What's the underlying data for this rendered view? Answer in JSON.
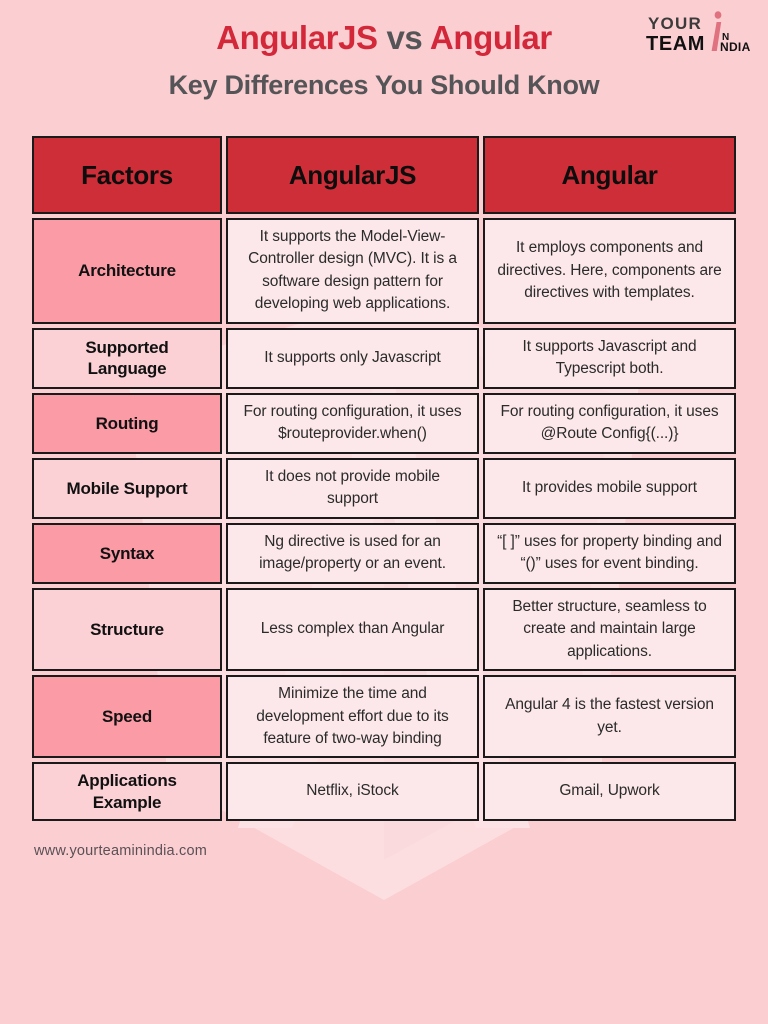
{
  "header": {
    "title_part1": "AngularJS",
    "title_vs": "vs",
    "title_part2": "Angular",
    "subtitle": "Key Differences You Should Know",
    "logo": {
      "line1": "YOUR",
      "line2": "TEAM",
      "mark": "i",
      "small1": "N",
      "small2": "NDIA",
      "alt": "Your Team In India"
    }
  },
  "table": {
    "columns": [
      "Factors",
      "AngularJS",
      "Angular"
    ],
    "rows": [
      {
        "factor": "Architecture",
        "angularjs": "It supports the Model-View-Controller design (MVC). It is a software design pattern for developing web applications.",
        "angular": "It employs components and directives. Here, components are directives with templates.",
        "shade": "dark"
      },
      {
        "factor": "Supported Language",
        "angularjs": "It supports only Javascript",
        "angular": "It supports Javascript and Typescript both.",
        "shade": "light"
      },
      {
        "factor": "Routing",
        "angularjs": "For routing configuration, it uses $routeprovider.when()",
        "angular": "For routing configuration, it uses @Route Config{(...)}",
        "shade": "dark"
      },
      {
        "factor": "Mobile Support",
        "angularjs": "It does not provide mobile support",
        "angular": "It provides mobile support",
        "shade": "light"
      },
      {
        "factor": "Syntax",
        "angularjs": "Ng directive is used for an image/property or an event.",
        "angular": "“[ ]” uses for property binding and “()” uses for event binding.",
        "shade": "dark"
      },
      {
        "factor": "Structure",
        "angularjs": "Less complex than Angular",
        "angular": "Better structure, seamless to create and maintain large applications.",
        "shade": "light"
      },
      {
        "factor": "Speed",
        "angularjs": "Minimize the time and development effort due to its feature of two-way binding",
        "angular": "Angular 4 is the fastest version yet.",
        "shade": "dark"
      },
      {
        "factor": "Applications Example",
        "angularjs": "Netflix, iStock",
        "angular": "Gmail, Upwork",
        "shade": "light"
      }
    ]
  },
  "footer": {
    "website": "www.yourteaminindia.com"
  },
  "colors": {
    "page_background": "#fbcfd2",
    "header_red": "#ce2e38",
    "title_red": "#d3283a",
    "title_gray": "#555558",
    "factor_dark": "#fa9ba6",
    "factor_light": "#fbd1d5",
    "content_cell": "#fce8ea",
    "border": "#1a1a1a",
    "watermark": "#fdeaec"
  }
}
